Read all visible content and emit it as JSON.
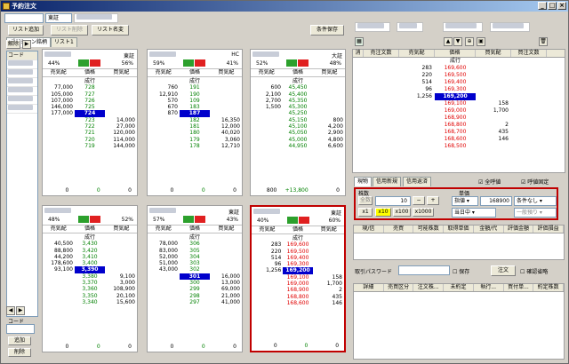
{
  "window": {
    "title": "予約注文"
  },
  "toolbar": {
    "market": "東証",
    "add_list": "リスト追加",
    "delete_list": "リスト削除",
    "rename_list": "リスト名変",
    "save_conditions": "条件保存"
  },
  "tabs": [
    "ポジション銘柄",
    "リスト1"
  ],
  "left": {
    "col": "コード",
    "delete_label": "解除",
    "code_label": "コード",
    "add_btn": "追加",
    "del_btn": "削除"
  },
  "headers": {
    "sell": "売気配",
    "price": "価格",
    "buy": "買気配",
    "market_order": "成行"
  },
  "colors": {
    "buy_green": "#2ca02c",
    "sell_red": "#e02020",
    "current_price": "#0000cc",
    "selected_border": "#c00000"
  },
  "panels": [
    {
      "market": "東証",
      "pct_left": "44%",
      "pct_right": "56%",
      "rows": [
        [
          "",
          "成行",
          ""
        ],
        [
          "77,000",
          "728",
          ""
        ],
        [
          "105,000",
          "727",
          ""
        ],
        [
          "107,000",
          "726",
          ""
        ],
        [
          "146,000",
          "725",
          ""
        ],
        [
          "177,000",
          "724",
          ""
        ],
        [
          "",
          "723",
          "14,000"
        ],
        [
          "",
          "722",
          "27,000"
        ],
        [
          "",
          "721",
          "120,000"
        ],
        [
          "",
          "720",
          "114,000"
        ],
        [
          "",
          "719",
          "144,000"
        ]
      ],
      "cur": 5,
      "foot": [
        "0",
        "0",
        "0"
      ]
    },
    {
      "market": "HC",
      "pct_left": "59%",
      "pct_right": "41%",
      "rows": [
        [
          "",
          "成行",
          ""
        ],
        [
          "760",
          "191",
          ""
        ],
        [
          "12,910",
          "190",
          ""
        ],
        [
          "570",
          "109",
          ""
        ],
        [
          "670",
          "183",
          ""
        ],
        [
          "870",
          "187",
          ""
        ],
        [
          "",
          "182",
          "16,350"
        ],
        [
          "",
          "181",
          "12,000"
        ],
        [
          "",
          "180",
          "40,020"
        ],
        [
          "",
          "179",
          "3,060"
        ],
        [
          "",
          "178",
          "12,710"
        ]
      ],
      "cur": 5,
      "foot": [
        "0",
        "0",
        "0"
      ]
    },
    {
      "market": "大証",
      "pct_left": "52%",
      "pct_right": "48%",
      "rows": [
        [
          "",
          "成行",
          ""
        ],
        [
          "600",
          "45,450",
          ""
        ],
        [
          "2,100",
          "45,400",
          ""
        ],
        [
          "2,700",
          "45,350",
          ""
        ],
        [
          "1,500",
          "45,300",
          ""
        ],
        [
          "",
          "45,250",
          ""
        ],
        [
          "",
          "45,150",
          "800"
        ],
        [
          "",
          "45,100",
          "4,200"
        ],
        [
          "",
          "45,050",
          "2,900"
        ],
        [
          "",
          "45,000",
          "4,800"
        ],
        [
          "",
          "44,950",
          "6,600"
        ]
      ],
      "cur": -1,
      "foot": [
        "800",
        "+13,800",
        "0"
      ]
    },
    {
      "market": "",
      "pct_left": "48%",
      "pct_right": "52%",
      "rows": [
        [
          "",
          "成行",
          ""
        ],
        [
          "40,500",
          "3,430",
          ""
        ],
        [
          "88,800",
          "3,420",
          ""
        ],
        [
          "44,200",
          "3,410",
          ""
        ],
        [
          "178,600",
          "3,400",
          ""
        ],
        [
          "93,100",
          "3,390",
          ""
        ],
        [
          "",
          "3,380",
          "9,100"
        ],
        [
          "",
          "3,370",
          "3,000"
        ],
        [
          "",
          "3,360",
          "108,900"
        ],
        [
          "",
          "3,350",
          "20,100"
        ],
        [
          "",
          "3,340",
          "15,600"
        ]
      ],
      "cur": 5,
      "foot": [
        "0",
        "0",
        "0"
      ]
    },
    {
      "market": "東証",
      "pct_left": "57%",
      "pct_right": "43%",
      "rows": [
        [
          "",
          "成行",
          ""
        ],
        [
          "78,000",
          "306",
          ""
        ],
        [
          "83,000",
          "305",
          ""
        ],
        [
          "52,000",
          "304",
          ""
        ],
        [
          "51,000",
          "303",
          ""
        ],
        [
          "43,000",
          "302",
          ""
        ],
        [
          "",
          "301",
          "16,000"
        ],
        [
          "",
          "300",
          "13,000"
        ],
        [
          "",
          "299",
          "69,000"
        ],
        [
          "",
          "298",
          "21,000"
        ],
        [
          "",
          "297",
          "41,000"
        ]
      ],
      "cur": 6,
      "foot": [
        "0",
        "0",
        "0"
      ]
    },
    {
      "market": "東証",
      "pct_left": "40%",
      "pct_right": "60%",
      "rows": [
        [
          "",
          "成行",
          ""
        ],
        [
          "283",
          "169,600",
          ""
        ],
        [
          "220",
          "169,500",
          ""
        ],
        [
          "514",
          "169,400",
          ""
        ],
        [
          "96",
          "169,300",
          ""
        ],
        [
          "1,256",
          "169,200",
          ""
        ],
        [
          "",
          "169,100",
          "158"
        ],
        [
          "",
          "169,000",
          "1,700"
        ],
        [
          "",
          "168,900",
          "2"
        ],
        [
          "",
          "168,800",
          "435"
        ],
        [
          "",
          "168,600",
          "146"
        ]
      ],
      "cur": 5,
      "foot": [
        "0",
        "0",
        "0"
      ]
    }
  ],
  "right_board": {
    "headers": [
      "消",
      "売注文数",
      "売気配",
      "価格",
      "買気配",
      "買注文数"
    ],
    "rows": [
      [
        "",
        "",
        "",
        "成行",
        "",
        ""
      ],
      [
        "",
        "",
        "283",
        "169,600",
        "",
        ""
      ],
      [
        "",
        "",
        "220",
        "169,500",
        "",
        ""
      ],
      [
        "",
        "",
        "514",
        "169,400",
        "",
        ""
      ],
      [
        "",
        "",
        "96",
        "169,300",
        "",
        ""
      ],
      [
        "",
        "",
        "1,256",
        "169,200",
        "",
        ""
      ],
      [
        "",
        "",
        "",
        "169,100",
        "158",
        ""
      ],
      [
        "",
        "",
        "",
        "169,000",
        "1,700",
        ""
      ],
      [
        "",
        "",
        "",
        "168,900",
        "",
        ""
      ],
      [
        "",
        "",
        "",
        "168,800",
        "2",
        ""
      ],
      [
        "",
        "",
        "",
        "168,700",
        "435",
        ""
      ],
      [
        "",
        "",
        "",
        "168,600",
        "146",
        ""
      ],
      [
        "",
        "",
        "",
        "168,500",
        "",
        ""
      ]
    ],
    "cur_price": "169,200",
    "cur_row": 6
  },
  "order": {
    "tabs": [
      "現物",
      "信用新規",
      "信用返済"
    ],
    "check_all": "全呼値",
    "check_fixed": "呼値固定",
    "qty_label": "株数",
    "price_label": "単価",
    "all_btn": "全数",
    "qty": "10",
    "x1": "x1",
    "x10": "x10",
    "x100": "x100",
    "x1000": "x1000",
    "price_type": "指値",
    "price_value": "168900",
    "condition": "条件なし",
    "period": "当日中",
    "inv_rule": "一般預り"
  },
  "olist_headers": [
    "現/信",
    "売買",
    "可能株数",
    "取得単価",
    "金額/代",
    "評価金額",
    "評価損益"
  ],
  "password": {
    "label": "取引パスワード",
    "save": "保存",
    "order_btn": "注文",
    "confirm": "確認省略"
  },
  "hlist_headers": [
    "詳細",
    "売買区分",
    "注文株...",
    "未約定",
    "執行...",
    "買付単...",
    "約定株数"
  ]
}
